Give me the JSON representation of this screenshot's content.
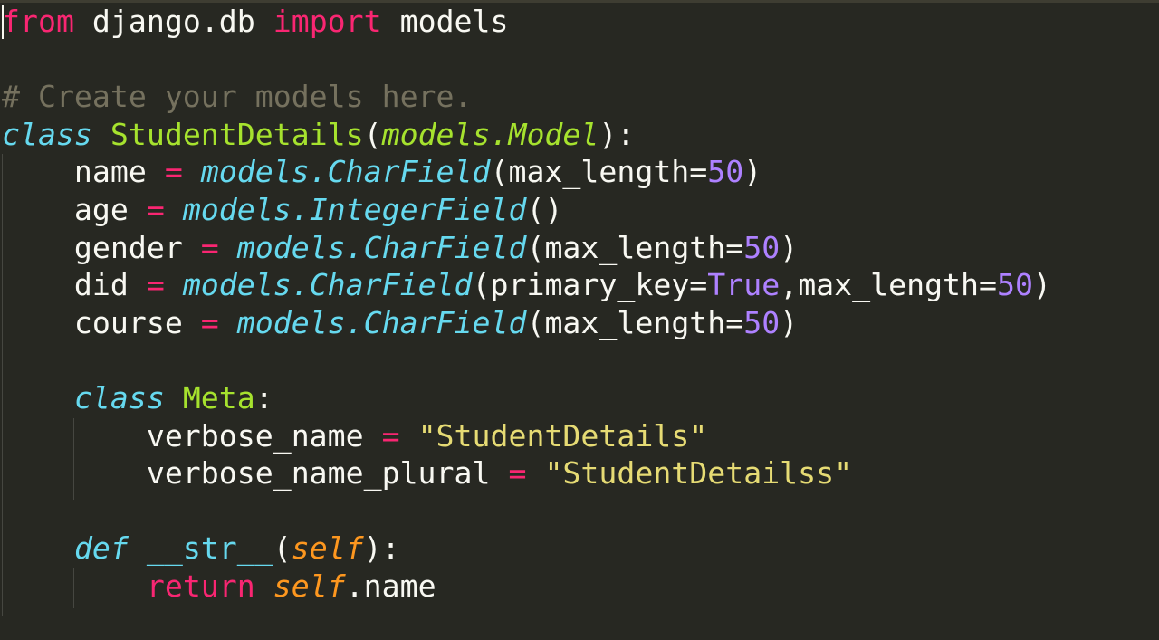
{
  "editor": {
    "theme": "monokai",
    "colors": {
      "background": "#272822",
      "foreground": "#f8f8f2",
      "keyword": "#f92672",
      "storage": "#66d9ef",
      "class_name": "#a6e22e",
      "number": "#ae81ff",
      "string": "#e6db74",
      "comment": "#75715e",
      "parameter": "#fd971f"
    },
    "lines": [
      {
        "tokens": [
          {
            "t": "kw",
            "v": "from"
          },
          {
            "t": "plain",
            "v": " django.db "
          },
          {
            "t": "kw",
            "v": "import"
          },
          {
            "t": "plain",
            "v": " models"
          }
        ]
      },
      {
        "tokens": []
      },
      {
        "tokens": [
          {
            "t": "cmt",
            "v": "# Create your models here."
          }
        ]
      },
      {
        "tokens": [
          {
            "t": "cls",
            "v": "class"
          },
          {
            "t": "plain",
            "v": " "
          },
          {
            "t": "name",
            "v": "StudentDetails"
          },
          {
            "t": "plain",
            "v": "("
          },
          {
            "t": "inh",
            "v": "models.Model"
          },
          {
            "t": "plain",
            "v": "):"
          }
        ]
      },
      {
        "tokens": [
          {
            "t": "plain",
            "v": "    name "
          },
          {
            "t": "op",
            "v": "="
          },
          {
            "t": "plain",
            "v": " "
          },
          {
            "t": "fn",
            "v": "models.CharField"
          },
          {
            "t": "plain",
            "v": "(max_length="
          },
          {
            "t": "num",
            "v": "50"
          },
          {
            "t": "plain",
            "v": ")"
          }
        ]
      },
      {
        "tokens": [
          {
            "t": "plain",
            "v": "    age "
          },
          {
            "t": "op",
            "v": "="
          },
          {
            "t": "plain",
            "v": " "
          },
          {
            "t": "fn",
            "v": "models.IntegerField"
          },
          {
            "t": "plain",
            "v": "()"
          }
        ]
      },
      {
        "tokens": [
          {
            "t": "plain",
            "v": "    gender "
          },
          {
            "t": "op",
            "v": "="
          },
          {
            "t": "plain",
            "v": " "
          },
          {
            "t": "fn",
            "v": "models.CharField"
          },
          {
            "t": "plain",
            "v": "(max_length="
          },
          {
            "t": "num",
            "v": "50"
          },
          {
            "t": "plain",
            "v": ")"
          }
        ]
      },
      {
        "tokens": [
          {
            "t": "plain",
            "v": "    did "
          },
          {
            "t": "op",
            "v": "="
          },
          {
            "t": "plain",
            "v": " "
          },
          {
            "t": "fn",
            "v": "models.CharField"
          },
          {
            "t": "plain",
            "v": "(primary_key="
          },
          {
            "t": "num",
            "v": "True"
          },
          {
            "t": "plain",
            "v": ",max_length="
          },
          {
            "t": "num",
            "v": "50"
          },
          {
            "t": "plain",
            "v": ")"
          }
        ]
      },
      {
        "tokens": [
          {
            "t": "plain",
            "v": "    course "
          },
          {
            "t": "op",
            "v": "="
          },
          {
            "t": "plain",
            "v": " "
          },
          {
            "t": "fn",
            "v": "models.CharField"
          },
          {
            "t": "plain",
            "v": "(max_length="
          },
          {
            "t": "num",
            "v": "50"
          },
          {
            "t": "plain",
            "v": ")"
          }
        ]
      },
      {
        "tokens": []
      },
      {
        "tokens": [
          {
            "t": "plain",
            "v": "    "
          },
          {
            "t": "cls",
            "v": "class"
          },
          {
            "t": "plain",
            "v": " "
          },
          {
            "t": "name",
            "v": "Meta"
          },
          {
            "t": "plain",
            "v": ":"
          }
        ]
      },
      {
        "tokens": [
          {
            "t": "plain",
            "v": "        verbose_name "
          },
          {
            "t": "op",
            "v": "="
          },
          {
            "t": "plain",
            "v": " "
          },
          {
            "t": "str",
            "v": "\"StudentDetails\""
          }
        ]
      },
      {
        "tokens": [
          {
            "t": "plain",
            "v": "        verbose_name_plural "
          },
          {
            "t": "op",
            "v": "="
          },
          {
            "t": "plain",
            "v": " "
          },
          {
            "t": "str",
            "v": "\"StudentDetailss\""
          }
        ]
      },
      {
        "tokens": []
      },
      {
        "tokens": [
          {
            "t": "plain",
            "v": "    "
          },
          {
            "t": "cls",
            "v": "def"
          },
          {
            "t": "plain",
            "v": " "
          },
          {
            "t": "magic",
            "v": "__str__"
          },
          {
            "t": "plain",
            "v": "("
          },
          {
            "t": "param",
            "v": "self"
          },
          {
            "t": "plain",
            "v": "):"
          }
        ]
      },
      {
        "tokens": [
          {
            "t": "plain",
            "v": "        "
          },
          {
            "t": "kw",
            "v": "return"
          },
          {
            "t": "plain",
            "v": " "
          },
          {
            "t": "param",
            "v": "self"
          },
          {
            "t": "plain",
            "v": ".name"
          }
        ]
      }
    ]
  }
}
